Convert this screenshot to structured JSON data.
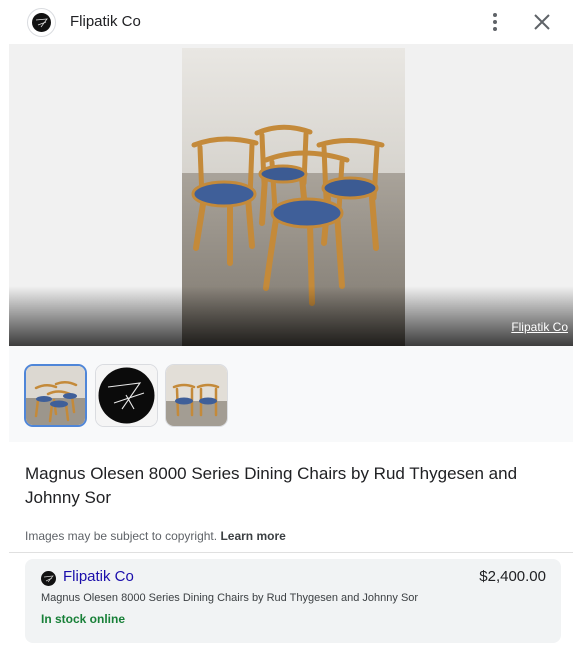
{
  "header": {
    "site_name": "Flipatik Co",
    "more_icon": "more-vert-icon",
    "close_icon": "close-icon"
  },
  "hero": {
    "credit": "Flipatik Co"
  },
  "thumbnails": [
    {
      "name": "chairs-photo-thumbnail",
      "selected": true
    },
    {
      "name": "logo-thumbnail",
      "selected": false
    },
    {
      "name": "chairs-photo-2-thumbnail",
      "selected": false
    }
  ],
  "product": {
    "title": "Magnus Olesen 8000 Series Dining Chairs by Rud Thygesen and Johnny Sor"
  },
  "copyright": {
    "text": "Images may be subject to copyright.",
    "learn_more": "Learn more"
  },
  "offer": {
    "seller": "Flipatik Co",
    "price": "$2,400.00",
    "description": "Magnus Olesen 8000 Series Dining Chairs by Rud Thygesen and Johnny Sor",
    "stock": "In stock online"
  },
  "colors": {
    "seller_link": "#1a0dab",
    "stock_green": "#188038",
    "selected_outline": "#4f86d8"
  }
}
